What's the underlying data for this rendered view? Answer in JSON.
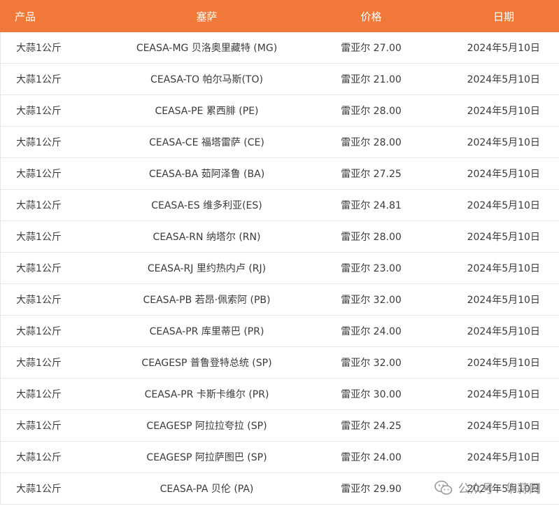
{
  "table": {
    "headers": {
      "product": "产品",
      "ceasa": "塞萨",
      "price": "价格",
      "date": "日期"
    },
    "rows": [
      {
        "product": "大蒜1公斤",
        "ceasa": "CEASA-MG 贝洛奥里藏特 (MG)",
        "price": "雷亚尔 27.00",
        "date": "2024年5月10日"
      },
      {
        "product": "大蒜1公斤",
        "ceasa": "CEASA-TO 帕尔马斯(TO)",
        "price": "雷亚尔 21.00",
        "date": "2024年5月10日"
      },
      {
        "product": "大蒜1公斤",
        "ceasa": "CEASA-PE 累西腓 (PE)",
        "price": "雷亚尔 28.00",
        "date": "2024年5月10日"
      },
      {
        "product": "大蒜1公斤",
        "ceasa": "CEASA-CE 福塔雷萨 (CE)",
        "price": "雷亚尔 28.00",
        "date": "2024年5月10日"
      },
      {
        "product": "大蒜1公斤",
        "ceasa": "CEASA-BA 茹阿泽鲁 (BA)",
        "price": "雷亚尔 27.25",
        "date": "2024年5月10日"
      },
      {
        "product": "大蒜1公斤",
        "ceasa": "CEASA-ES 维多利亚(ES)",
        "price": "雷亚尔 24.81",
        "date": "2024年5月10日"
      },
      {
        "product": "大蒜1公斤",
        "ceasa": "CEASA-RN 纳塔尔 (RN)",
        "price": "雷亚尔 28.00",
        "date": "2024年5月10日"
      },
      {
        "product": "大蒜1公斤",
        "ceasa": "CEASA-RJ 里约热内卢 (RJ)",
        "price": "雷亚尔 23.00",
        "date": "2024年5月10日"
      },
      {
        "product": "大蒜1公斤",
        "ceasa": "CEASA-PB 若昂·佩索阿 (PB)",
        "price": "雷亚尔 32.00",
        "date": "2024年5月10日"
      },
      {
        "product": "大蒜1公斤",
        "ceasa": "CEASA-PR 库里蒂巴 (PR)",
        "price": "雷亚尔 24.00",
        "date": "2024年5月10日"
      },
      {
        "product": "大蒜1公斤",
        "ceasa": "CEAGESP 普鲁登特总统 (SP)",
        "price": "雷亚尔 32.00",
        "date": "2024年5月10日"
      },
      {
        "product": "大蒜1公斤",
        "ceasa": "CEASA-PR 卡斯卡维尔 (PR)",
        "price": "雷亚尔 30.00",
        "date": "2024年5月10日"
      },
      {
        "product": "大蒜1公斤",
        "ceasa": "CEAGESP 阿拉拉夸拉 (SP)",
        "price": "雷亚尔 24.25",
        "date": "2024年5月10日"
      },
      {
        "product": "大蒜1公斤",
        "ceasa": "CEAGESP 阿拉萨图巴 (SP)",
        "price": "雷亚尔 24.00",
        "date": "2024年5月10日"
      },
      {
        "product": "大蒜1公斤",
        "ceasa": "CEASA-PA 贝伦 (PA)",
        "price": "雷亚尔 29.90",
        "date": "2024年5月10日"
      }
    ]
  },
  "watermark": {
    "icon": "wechat-icon",
    "text": "公众号 · 华蒜网"
  },
  "colors": {
    "header_bg": "#f0793a",
    "header_text": "#ffffff",
    "border": "#e7e7e7"
  }
}
